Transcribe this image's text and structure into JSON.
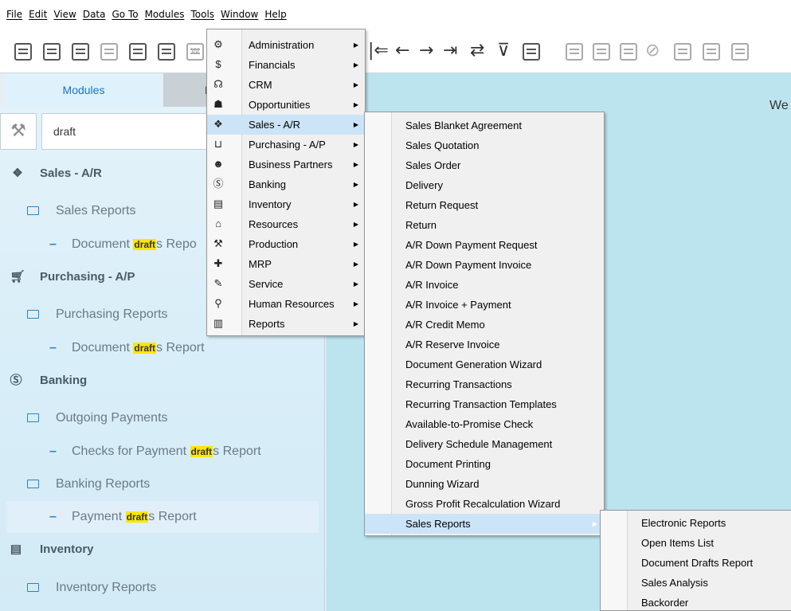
{
  "menubar": {
    "items": [
      "File",
      "Edit",
      "View",
      "Data",
      "Go To",
      "Modules",
      "Tools",
      "Window",
      "Help"
    ]
  },
  "left_panel": {
    "tab_modules": "Modules",
    "tab_other_fragment": "D",
    "search_value": "draft",
    "tree": {
      "sales_ar": "Sales - A/R",
      "sales_reports": "Sales Reports",
      "sales_doc_pre": "Document ",
      "sales_doc_hl": "draft",
      "sales_doc_post": "s Repo",
      "purchasing": "Purchasing - A/P",
      "purchasing_reports": "Purchasing Reports",
      "purch_doc_pre": "Document ",
      "purch_doc_hl": "draft",
      "purch_doc_post": "s Report",
      "banking": "Banking",
      "outgoing_payments": "Outgoing Payments",
      "checks_pre": "Checks for Payment ",
      "checks_hl": "draft",
      "checks_post": "s Report",
      "banking_reports": "Banking Reports",
      "payment_pre": "Payment ",
      "payment_hl": "draft",
      "payment_post": "s Report",
      "inventory": "Inventory",
      "inventory_reports": "Inventory Reports"
    }
  },
  "content": {
    "welcome_fragment": "We"
  },
  "toolbar": {
    "partial_label": "W"
  },
  "modules_menu": {
    "items": [
      "Administration",
      "Financials",
      "CRM",
      "Opportunities",
      "Sales - A/R",
      "Purchasing - A/P",
      "Business Partners",
      "Banking",
      "Inventory",
      "Resources",
      "Production",
      "MRP",
      "Service",
      "Human Resources",
      "Reports"
    ]
  },
  "sales_menu": {
    "items": [
      "Sales Blanket Agreement",
      "Sales Quotation",
      "Sales Order",
      "Delivery",
      "Return Request",
      "Return",
      "A/R Down Payment Request",
      "A/R Down Payment Invoice",
      "A/R Invoice",
      "A/R Invoice + Payment",
      "A/R Credit Memo",
      "A/R Reserve Invoice",
      "Document Generation Wizard",
      "Recurring Transactions",
      "Recurring Transaction Templates",
      "Available-to-Promise Check",
      "Delivery Schedule Management",
      "Document Printing",
      "Dunning Wizard",
      "Gross Profit Recalculation Wizard",
      "Sales Reports"
    ]
  },
  "reports_menu": {
    "items": [
      "Electronic Reports",
      "Open Items List",
      "Document Drafts Report",
      "Sales Analysis",
      "Backorder"
    ]
  },
  "colors": {
    "menu_highlight": "#cce4f7",
    "panel_bg": "#d9eef8",
    "content_bg": "#bce4ef",
    "search_highlight": "#ffe600",
    "accent_blue": "#1a73c9"
  }
}
